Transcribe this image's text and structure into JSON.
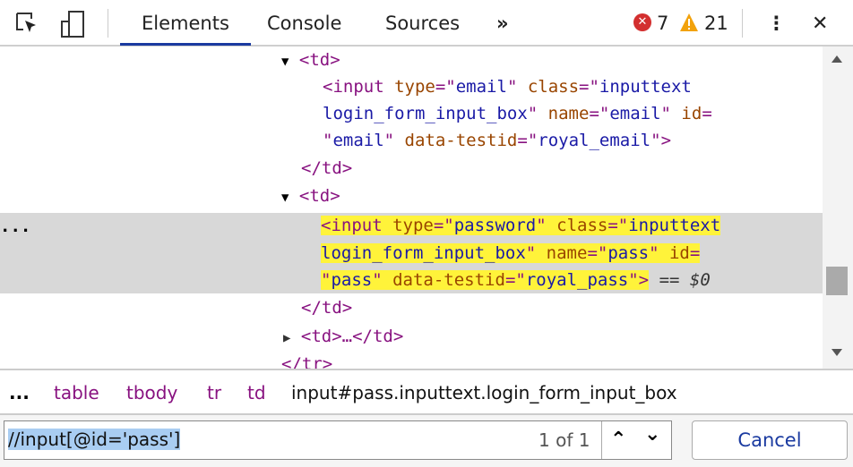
{
  "toolbar": {
    "tabs": [
      "Elements",
      "Console",
      "Sources"
    ],
    "more": "»",
    "errors": "7",
    "warnings": "21",
    "menu": "⋮",
    "close": "✕"
  },
  "code": {
    "l1": [
      "▼",
      "<td>"
    ],
    "l2": [
      "<input ",
      "type",
      "=\"",
      "email",
      "\" ",
      "class",
      "=\"",
      "inputtext"
    ],
    "l3": [
      "login_form_input_box",
      "\" ",
      "name",
      "=\"",
      "email",
      "\" ",
      "id",
      "="
    ],
    "l4": [
      "\"",
      "email",
      "\" ",
      "data-testid",
      "=\"",
      "royal_email",
      "\">"
    ],
    "l5": "</td>",
    "l6": [
      "▼",
      "<td>"
    ],
    "l7": [
      "<input ",
      "type",
      "=\"",
      "password",
      "\" ",
      "class",
      "=\"",
      "inputtext"
    ],
    "l8": [
      "login_form_input_box",
      "\" ",
      "name",
      "=\"",
      "pass",
      "\" ",
      "id",
      "="
    ],
    "l9": [
      "\"",
      "pass",
      "\" ",
      "data-testid",
      "=\"",
      "royal_pass",
      "\">"
    ],
    "eq": "== $0",
    "dots": "...",
    "l10": "</td>",
    "l11": [
      "▶",
      "<td>…</td>"
    ],
    "l12": "</tr>"
  },
  "breadcrumbs": {
    "ellipsis": "...",
    "items": [
      "table",
      "tbody",
      "tr",
      "td"
    ],
    "current": "input#pass.inputtext.login_form_input_box"
  },
  "search": {
    "value": "//input[@id='pass']",
    "count": "1 of 1",
    "up": "⌃",
    "down": "⌄",
    "cancel": "Cancel"
  },
  "colors": {
    "tag": "#881280",
    "attr_name": "#994500",
    "attr_value": "#1a1aa6",
    "highlight": "#fff33a",
    "accent": "#1a3aa0"
  }
}
